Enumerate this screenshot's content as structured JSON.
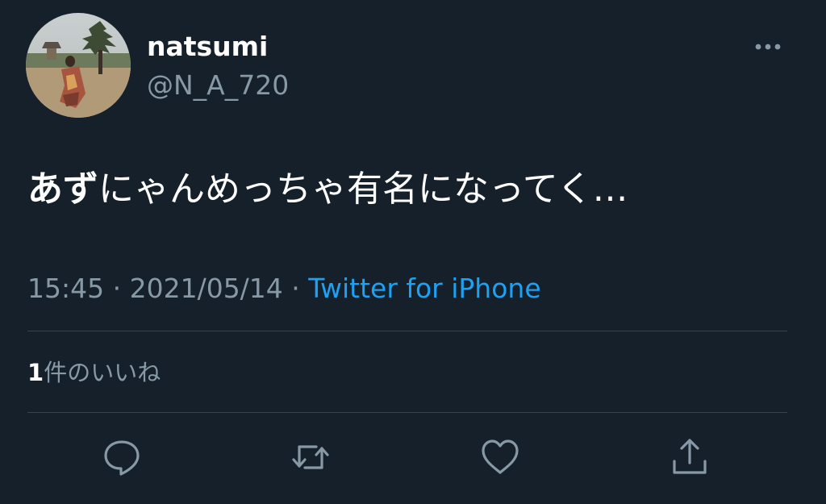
{
  "user": {
    "display_name": "natsumi",
    "handle": "@N_A_720"
  },
  "tweet": {
    "text_bold": "あず",
    "text_rest": "にゃんめっちゃ有名になってく…",
    "time": "15:45",
    "separator1": " · ",
    "date": "2021/05/14",
    "separator2": " · ",
    "source": "Twitter for iPhone"
  },
  "stats": {
    "likes_count": "1",
    "likes_label": "件のいいね"
  },
  "icons": {
    "more": "more-horizontal-icon",
    "reply": "reply-icon",
    "retweet": "retweet-icon",
    "like": "heart-icon",
    "share": "share-icon"
  },
  "colors": {
    "background": "#15202b",
    "secondary_text": "#8899a6",
    "link": "#1da1f2",
    "divider": "#38444d"
  }
}
